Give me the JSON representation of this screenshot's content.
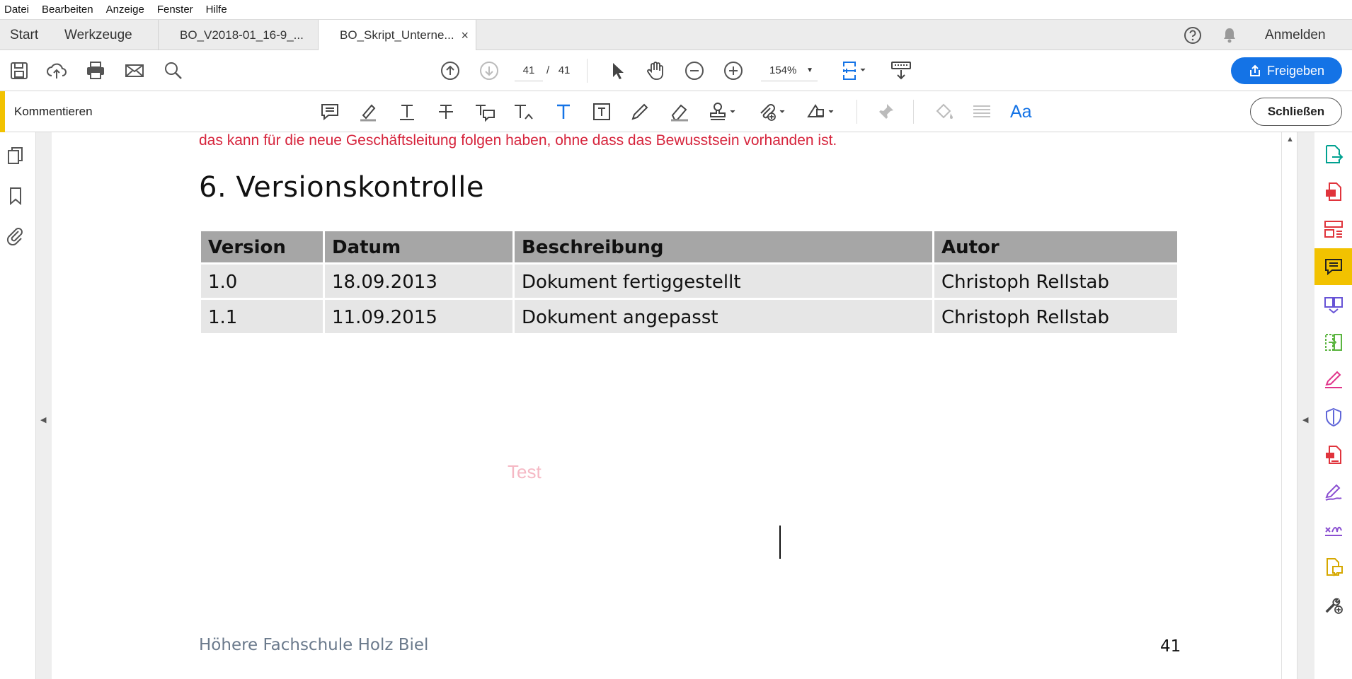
{
  "menu": [
    "Datei",
    "Bearbeiten",
    "Anzeige",
    "Fenster",
    "Hilfe"
  ],
  "tabs": {
    "start": "Start",
    "tools": "Werkzeuge",
    "doc1": "BO_V2018-01_16-9_...",
    "doc2": "BO_Skript_Unterne...",
    "close_glyph": "×",
    "login": "Anmelden"
  },
  "toolbar": {
    "page_current": "41",
    "page_sep": "/",
    "page_total": "41",
    "zoom": "154%",
    "share_label": "Freigeben"
  },
  "commentbar": {
    "title": "Kommentieren",
    "font_label": "Aa",
    "close_label": "Schließen"
  },
  "document": {
    "red_text": "das kann für die neue Geschäftsleitung folgen haben, ohne dass das Bewusstsein vorhanden ist.",
    "heading": "6. Versionskontrolle",
    "table": {
      "headers": [
        "Version",
        "Datum",
        "Beschreibung",
        "Autor"
      ],
      "rows": [
        [
          "1.0",
          "18.09.2013",
          "Dokument fertiggestellt",
          "Christoph Rellstab"
        ],
        [
          "1.1",
          "11.09.2015",
          "Dokument angepasst",
          "Christoph Rellstab"
        ]
      ]
    },
    "watermark": "Test",
    "footer_left": "Höhere Fachschule Holz Biel",
    "page_number": "41"
  },
  "colors": {
    "accent_yellow": "#f2c200",
    "share_blue": "#1473e6",
    "red_text": "#d6243c"
  }
}
